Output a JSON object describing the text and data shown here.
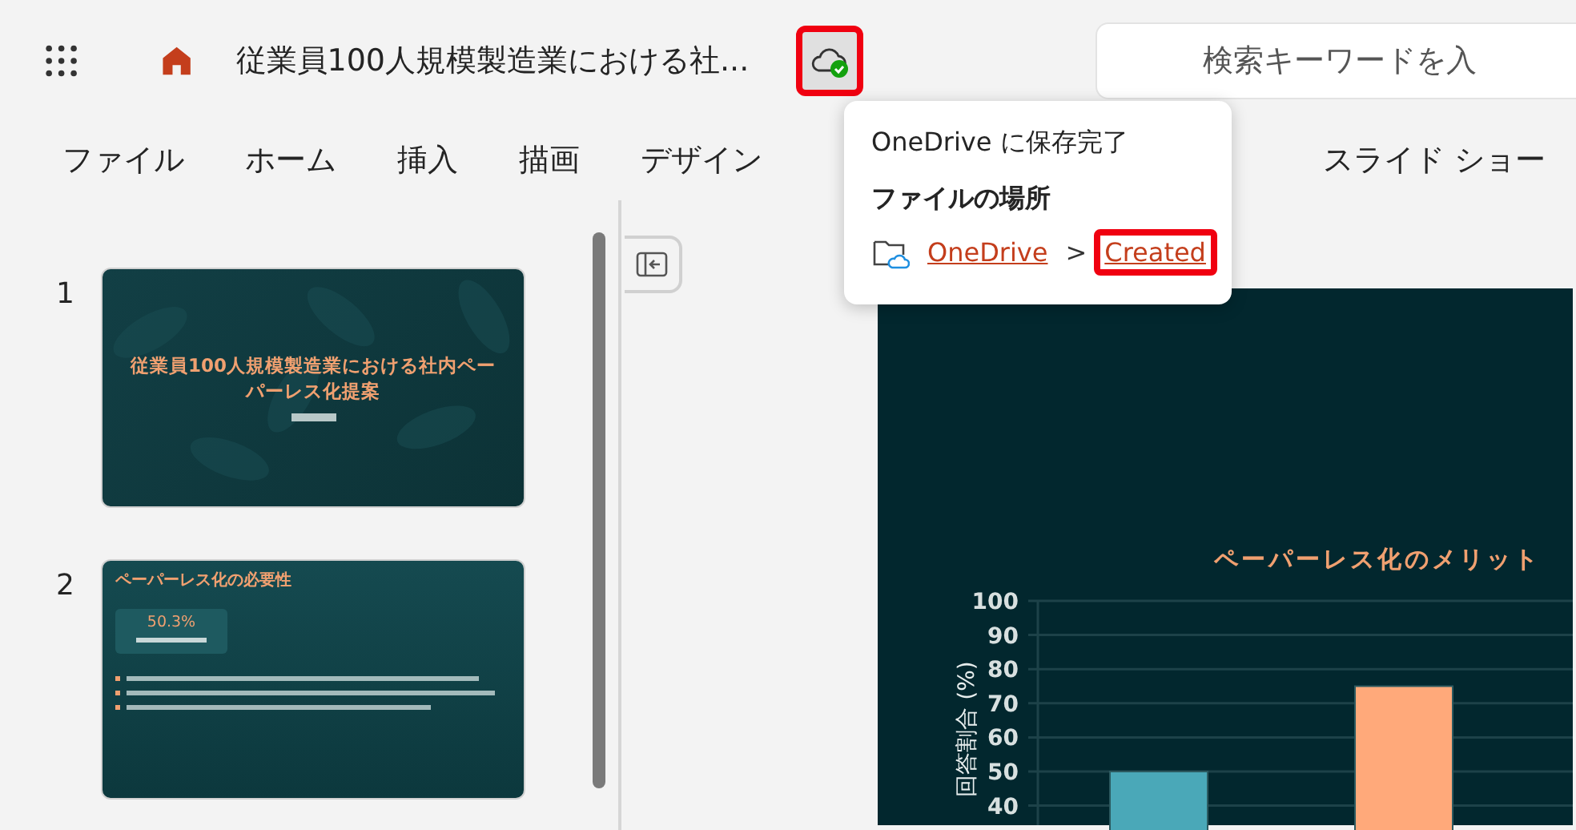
{
  "topbar": {
    "title": "従業員100人規模製造業における社...",
    "save_status": {
      "highlighted": true
    },
    "search": {
      "placeholder": "検索キーワードを入"
    }
  },
  "ribbon_tabs": [
    {
      "label": "ファイル"
    },
    {
      "label": "ホーム"
    },
    {
      "label": "挿入"
    },
    {
      "label": "描画"
    },
    {
      "label": "デザイン"
    },
    {
      "label": "スライド ショー"
    }
  ],
  "save_popup": {
    "message": "OneDrive に保存完了",
    "heading": "ファイルの場所",
    "separator": ">",
    "path": [
      {
        "label": "OneDrive",
        "highlighted": false
      },
      {
        "label": "Created",
        "highlighted": true
      }
    ]
  },
  "slides": [
    {
      "number": "1",
      "kind": "title",
      "title": "従業員100人規模製造業における社内ペーパーレス化提案"
    },
    {
      "number": "2",
      "kind": "content",
      "title": "ペーパーレス化の必要性",
      "stat": "50.3%"
    }
  ],
  "stage": {
    "chart_data": {
      "type": "bar",
      "title": "ペーパーレス化のメリット",
      "ylabel": "回答割合 (%)",
      "values": [
        50,
        75
      ],
      "colors": [
        "#4aa8b8",
        "#ffa97a"
      ],
      "ylim": [
        0,
        100
      ],
      "grid": true,
      "yticks": [
        40,
        50,
        60,
        70,
        80,
        90,
        100
      ]
    }
  }
}
